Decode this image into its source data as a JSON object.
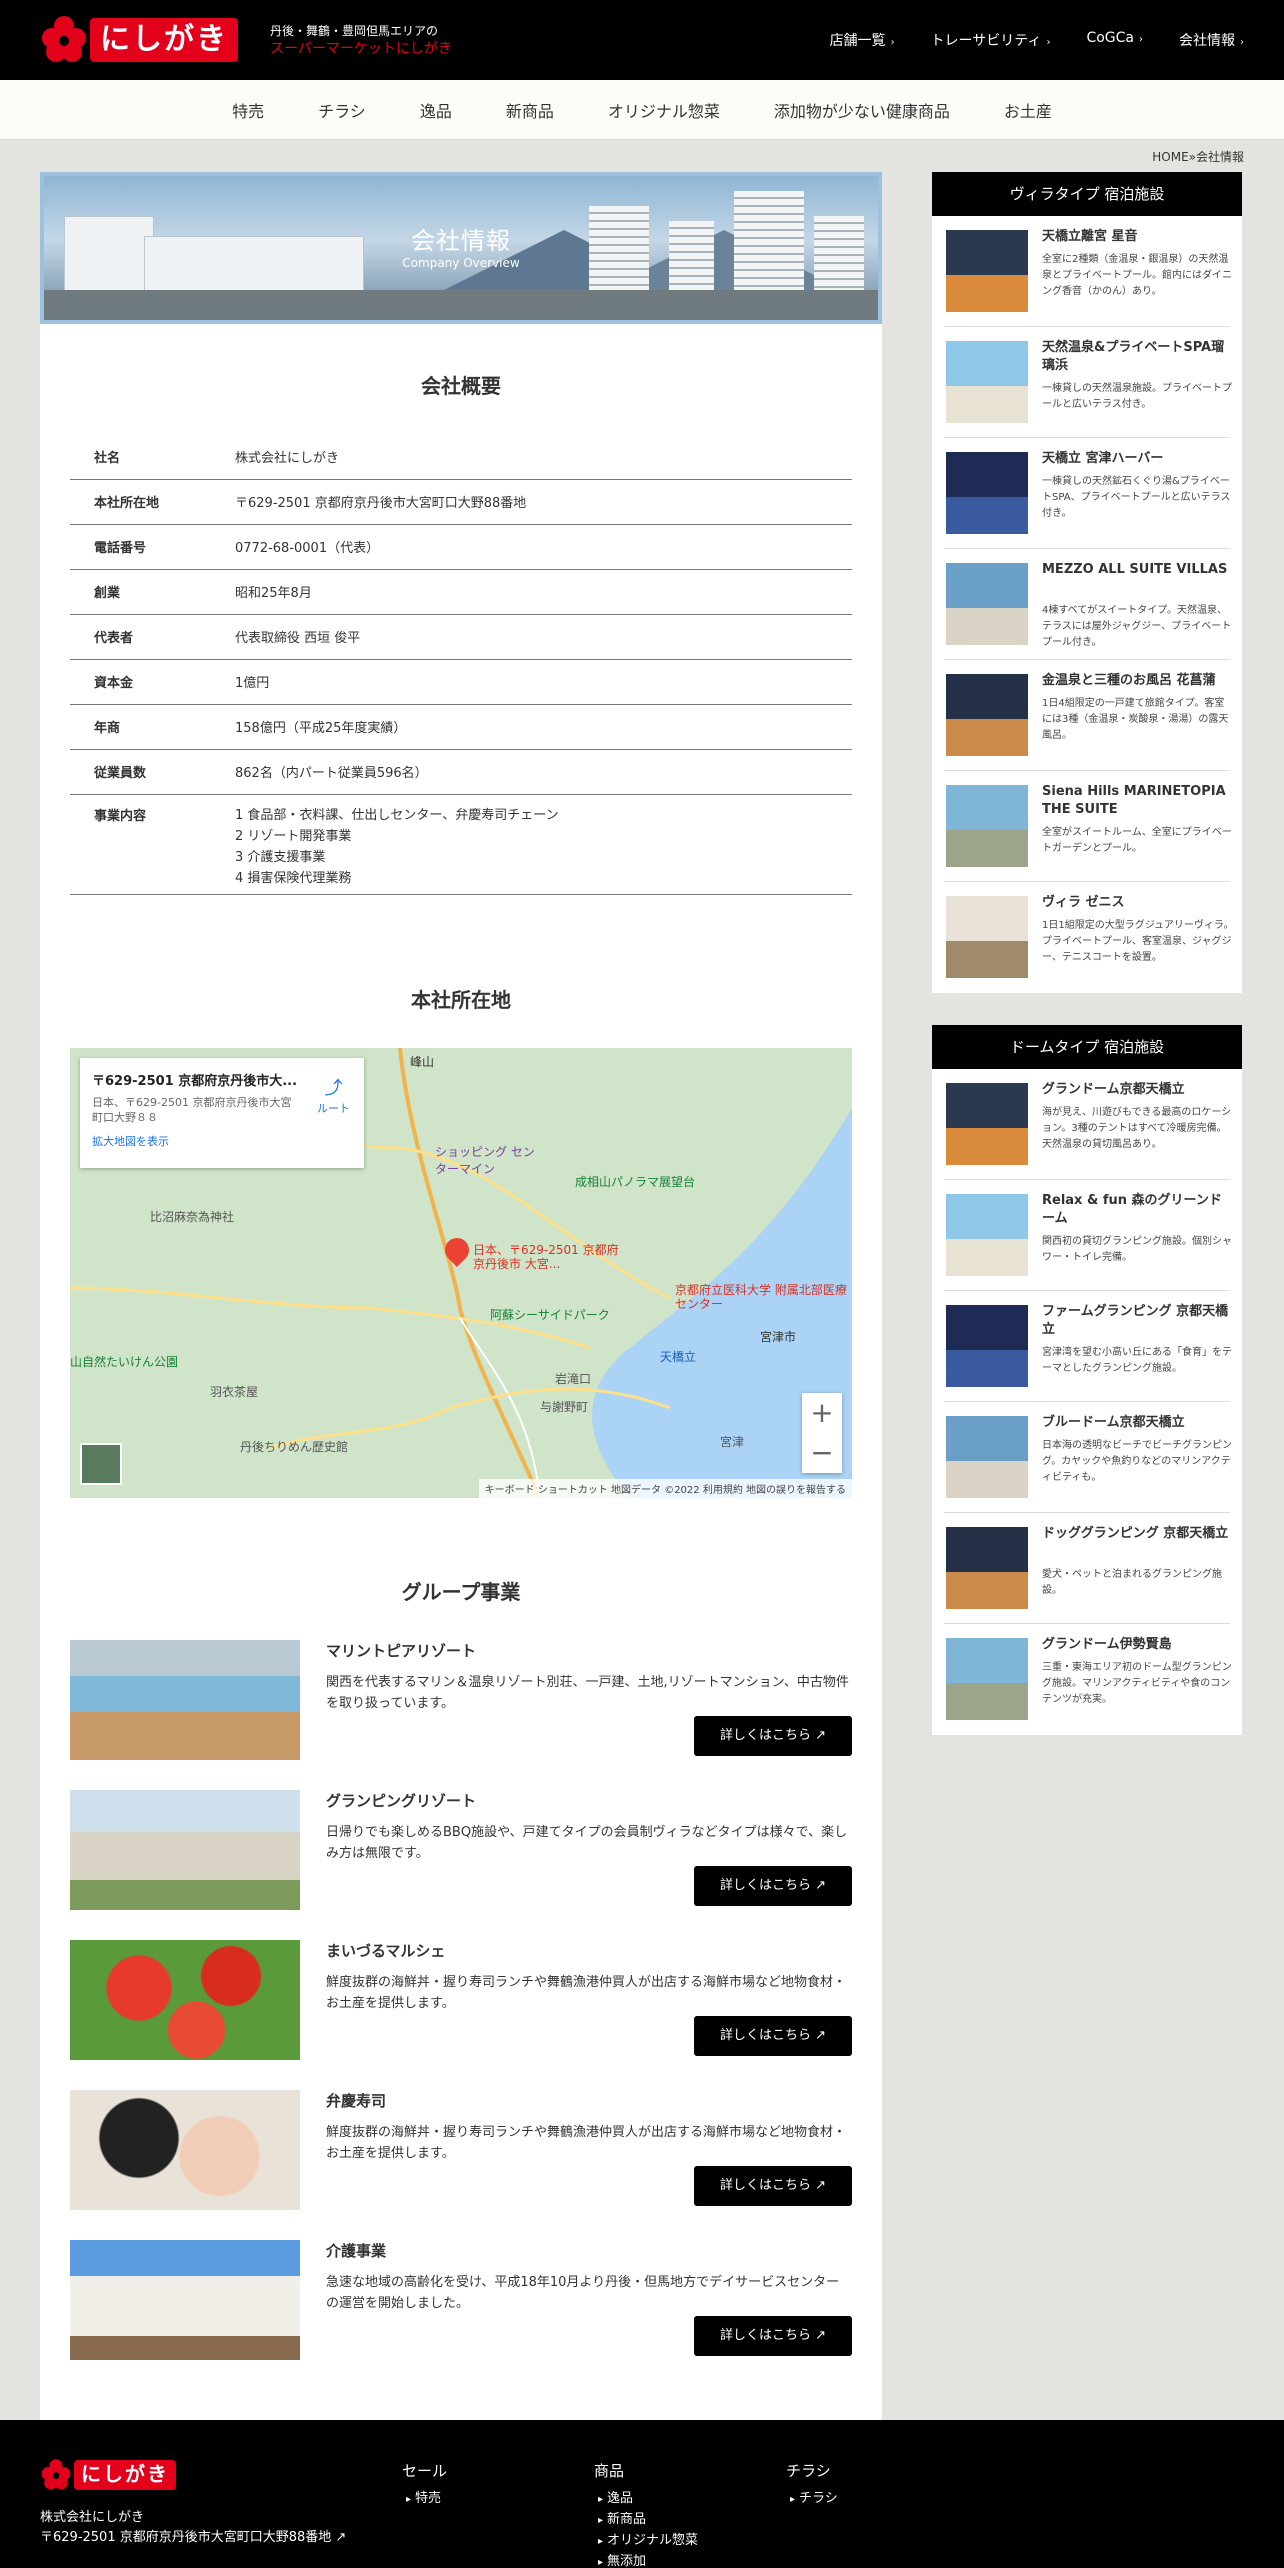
{
  "header": {
    "logo_text": "にしがき",
    "tagline_1": "丹後・舞鶴・豊岡但馬エリアの",
    "tagline_2": "スーパーマーケットにしがき",
    "nav": [
      "店舗一覧",
      "トレーサビリティ",
      "CoGCa",
      "会社情報"
    ],
    "categories": [
      "特売",
      "チラシ",
      "逸品",
      "新商品",
      "オリジナル惣菜",
      "添加物が少ない健康商品",
      "お土産"
    ]
  },
  "breadcrumb": "HOME»会社情報",
  "hero": {
    "title": "会社情報",
    "subtitle": "Company Overview"
  },
  "company": {
    "heading": "会社概要",
    "rows": [
      {
        "k": "社名",
        "v": "株式会社にしがき"
      },
      {
        "k": "本社所在地",
        "v": "〒629-2501 京都府京丹後市大宮町口大野88番地"
      },
      {
        "k": "電話番号",
        "v": "0772-68-0001（代表）"
      },
      {
        "k": "創業",
        "v": "昭和25年8月"
      },
      {
        "k": "代表者",
        "v": "代表取締役 西垣 俊平"
      },
      {
        "k": "資本金",
        "v": "1億円"
      },
      {
        "k": "年商",
        "v": "158億円（平成25年度実績）"
      },
      {
        "k": "従業員数",
        "v": "862名（内パート従業員596名）"
      }
    ],
    "business_key": "事業内容",
    "business": [
      "1 食品部・衣料課、仕出しセンター、弁慶寿司チェーン",
      "2 リゾート開発事業",
      "3 介護支援事業",
      "4 損害保険代理業務"
    ]
  },
  "map": {
    "heading": "本社所在地",
    "card_title": "〒629-2501 京都府京丹後市大...",
    "card_addr": "日本、〒629-2501 京都府京丹後市大宮町口大野８８",
    "card_link": "拡大地図を表示",
    "route": "ルート",
    "pin_label": "日本、〒629-2501 京都府京丹後市 大宮...",
    "labels": [
      "峰山",
      "ショッピング センターマイン",
      "成相山パノラマ展望台",
      "比沼麻奈為神社",
      "阿蘇シーサイドパーク",
      "京都府立医科大学 附属北部医療センター",
      "天橋立",
      "宮津市",
      "山自然たいけん公園",
      "羽衣茶屋",
      "丹後ちりめん歴史館",
      "与謝野町",
      "岩滝口",
      "宮津"
    ],
    "footer": "キーボード ショートカット   地図データ ©2022   利用規約   地図の誤りを報告する"
  },
  "groups": {
    "heading": "グループ事業",
    "button": "詳しくはこちら",
    "items": [
      {
        "name": "マリントピアリゾート",
        "desc": "関西を代表するマリン＆温泉リゾート別荘、一戸建、土地,リゾートマンション、中古物件を取り扱っています。"
      },
      {
        "name": "グランピングリゾート",
        "desc": "日帰りでも楽しめるBBQ施設や、戸建てタイプの会員制ヴィラなどタイプは様々で、楽しみ方は無限です。"
      },
      {
        "name": "まいづるマルシェ",
        "desc": "鮮度抜群の海鮮丼・握り寿司ランチや舞鶴漁港仲買人が出店する海鮮市場など地物食材・お土産を提供します。"
      },
      {
        "name": "弁慶寿司",
        "desc": "鮮度抜群の海鮮丼・握り寿司ランチや舞鶴漁港仲買人が出店する海鮮市場など地物食材・お土産を提供します。"
      },
      {
        "name": "介護事業",
        "desc": "急速な地域の高齢化を受け、平成18年10月より丹後・但馬地方でデイサービスセンターの運営を開始しました。"
      }
    ]
  },
  "sidebar_villa": {
    "heading": "ヴィラタイプ 宿泊施設",
    "items": [
      {
        "name": "天橋立離宮 星音",
        "desc": "全室に2種類（金温泉・銀温泉）の天然温泉とプライベートプール。館内にはダイニング香音（かのん）あり。"
      },
      {
        "name": "天然温泉&プライベートSPA瑠璃浜",
        "desc": "一棟貸しの天然温泉施設。プライベートプールと広いテラス付き。"
      },
      {
        "name": "天橋立 宮津ハーバー",
        "desc": "一棟貸しの天然鉱石くぐり湯&プライベートSPA、プライベートプールと広いテラス付き。"
      },
      {
        "name": "MEZZO ALL SUITE VILLAS",
        "desc": "4棟すべてがスイートタイプ。天然温泉、テラスには屋外ジャグジー、プライベートプール付き。"
      },
      {
        "name": "金温泉と三種のお風呂 花菖蒲",
        "desc": "1日4組限定の一戸建て旅館タイプ。客室には3種（金温泉・炭酸泉・湯湯）の露天風呂。"
      },
      {
        "name": "Siena Hills MARINETOPIA THE SUITE",
        "desc": "全室がスイートルーム、全室にプライベートガーデンとプール。"
      },
      {
        "name": "ヴィラ ゼニス",
        "desc": "1日1組限定の大型ラグジュアリーヴィラ。プライベートプール、客室温泉、ジャグジー、テニスコートを設置。"
      }
    ]
  },
  "sidebar_dome": {
    "heading": "ドームタイプ 宿泊施設",
    "items": [
      {
        "name": "グランドーム京都天橋立",
        "desc": "海が見え、川遊びもできる最高のロケーション。3種のテントはすべて冷暖房完備。天然温泉の貸切風呂あり。"
      },
      {
        "name": "Relax & fun 森のグリーンドーム",
        "desc": "関西初の貸切グランピング施設。個別シャワー・トイレ完備。"
      },
      {
        "name": "ファームグランピング 京都天橋立",
        "desc": "宮津湾を望む小高い丘にある「食育」をテーマとしたグランピング施設。"
      },
      {
        "name": "ブルードーム京都天橋立",
        "desc": "日本海の透明なビーチでビーチグランピング。カヤックや魚釣りなどのマリンアクティビティも。"
      },
      {
        "name": "ドッググランピング 京都天橋立",
        "desc": "愛犬・ペットと泊まれるグランピング施設。"
      },
      {
        "name": "グランドーム伊勢賢島",
        "desc": "三重・東海エリア初のドーム型グランピング施設。マリンアクティビティや食のコンテンツが充実。"
      }
    ]
  },
  "footer": {
    "company": "株式会社にしがき",
    "address": "〒629-2501 京都府京丹後市大宮町口大野88番地",
    "cols": [
      {
        "head": "セール",
        "items": [
          "特売"
        ]
      },
      {
        "head": "商品",
        "items": [
          "逸品",
          "新商品",
          "オリジナル惣菜",
          "無添加"
        ]
      },
      {
        "head": "チラシ",
        "items": [
          "チラシ"
        ]
      }
    ]
  },
  "colors": {
    "brand_red": "#e3001b",
    "header_bg": "#000000",
    "page_bg": "#e3e3df"
  }
}
